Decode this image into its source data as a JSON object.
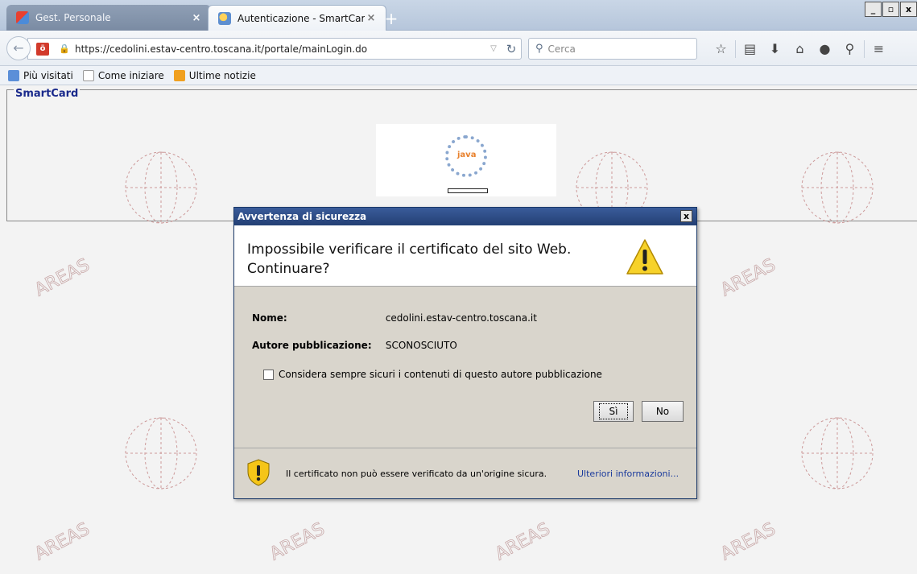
{
  "window": {
    "tabs": [
      {
        "title": "Gest. Personale",
        "close": "×"
      },
      {
        "title": "Autenticazione - SmartCard",
        "close": "×"
      }
    ],
    "new_tab": "+",
    "controls": [
      "_",
      "▫",
      "x"
    ]
  },
  "navbar": {
    "url": "https://cedolini.estav-centro.toscana.it/portale/mainLogin.do",
    "search_placeholder": "Cerca"
  },
  "bookmarks": [
    "Più visitati",
    "Come iniziare",
    "Ultime notizie"
  ],
  "page": {
    "legend": "SmartCard",
    "applet_label": "java",
    "watermark_text": "AREAS"
  },
  "dialog": {
    "title": "Avvertenza di sicurezza",
    "close": "x",
    "question": "Impossibile verificare il certificato del sito Web. Continuare?",
    "name_label": "Nome:",
    "name_value": "cedolini.estav-centro.toscana.it",
    "publisher_label": "Autore pubblicazione:",
    "publisher_value": "SCONOSCIUTO",
    "checkbox_label": "Considera sempre sicuri i contenuti di questo autore pubblicazione",
    "yes_button": "Sì",
    "no_button": "No",
    "footer_message": "Il certificato non può essere verificato da un'origine sicura.",
    "footer_link": "Ulteriori informazioni..."
  }
}
